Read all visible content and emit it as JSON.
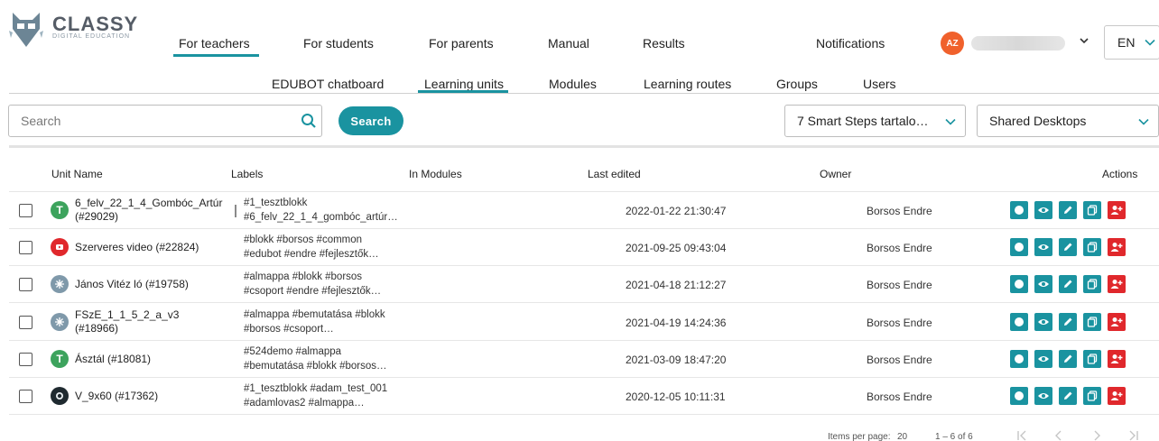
{
  "brand": {
    "name": "CLASSY",
    "tagline": "DIGITAL EDUCATION"
  },
  "top_nav": [
    {
      "label": "For teachers",
      "active": true
    },
    {
      "label": "For students"
    },
    {
      "label": "For parents"
    },
    {
      "label": "Manual"
    },
    {
      "label": "Results"
    },
    {
      "label": "Notifications"
    }
  ],
  "user": {
    "initials": "AZ",
    "avatar_color": "#f0612c"
  },
  "language": {
    "value": "EN"
  },
  "sub_nav": [
    {
      "label": "EDUBOT chatboard"
    },
    {
      "label": "Learning units",
      "active": true
    },
    {
      "label": "Modules"
    },
    {
      "label": "Learning routes"
    },
    {
      "label": "Groups"
    },
    {
      "label": "Users"
    }
  ],
  "toolbar": {
    "search_placeholder": "Search",
    "search_value": "",
    "search_button": "Search",
    "filter_1": "7 Smart Steps tartalo…",
    "filter_2": "Shared Desktops"
  },
  "table": {
    "columns": {
      "unit_name": "Unit Name",
      "labels": "Labels",
      "in_modules": "In Modules",
      "last_edited": "Last edited",
      "owner": "Owner",
      "actions": "Actions"
    },
    "rows": [
      {
        "icon": "letter-t-icon",
        "icon_text": "T",
        "icon_color": "#3da35d",
        "name_line1": "6_felv_22_1_4_Gombóc_Artúr",
        "name_line2": "(#29029)",
        "labels_line1": "#1_tesztblokk",
        "labels_line2": "#6_felv_22_1_4_gombóc_artúr…",
        "in_modules": "",
        "last_edited": "2022-01-22 21:30:47",
        "owner": "Borsos Endre"
      },
      {
        "icon": "video-play-icon",
        "icon_text": "",
        "icon_color": "#e0282c",
        "name_line1": "Szerveres video (#22824)",
        "name_line2": "",
        "labels_line1": "#blokk #borsos #common",
        "labels_line2": "#edubot #endre #fejlesztők…",
        "in_modules": "",
        "last_edited": "2021-09-25 09:43:04",
        "owner": "Borsos Endre"
      },
      {
        "icon": "unit-logo-icon",
        "icon_text": "",
        "icon_color": "#7f99aa",
        "name_line1": "János Vitéz ló (#19758)",
        "name_line2": "",
        "labels_line1": "#almappa #blokk #borsos",
        "labels_line2": "#csoport #endre #fejlesztők…",
        "in_modules": "",
        "last_edited": "2021-04-18 21:12:27",
        "owner": "Borsos Endre"
      },
      {
        "icon": "unit-logo-icon",
        "icon_text": "",
        "icon_color": "#7f99aa",
        "name_line1": "FSzE_1_1_5_2_a_v3",
        "name_line2": "(#18966)",
        "labels_line1": "#almappa #bemutatása #blokk",
        "labels_line2": "#borsos #csoport…",
        "in_modules": "",
        "last_edited": "2021-04-19 14:24:36",
        "owner": "Borsos Endre"
      },
      {
        "icon": "letter-t-icon",
        "icon_text": "T",
        "icon_color": "#3da35d",
        "name_line1": "Ásztál (#18081)",
        "name_line2": "",
        "labels_line1": "#524demo #almappa",
        "labels_line2": "#bemutatása #blokk #borsos…",
        "in_modules": "",
        "last_edited": "2021-03-09 18:47:20",
        "owner": "Borsos Endre"
      },
      {
        "icon": "dark-circle-icon",
        "icon_text": "",
        "icon_color": "#1f2a30",
        "name_line1": "V_9x60 (#17362)",
        "name_line2": "",
        "labels_line1": "#1_tesztblokk #adam_test_001",
        "labels_line2": "#adamlovas2 #almappa…",
        "in_modules": "",
        "last_edited": "2020-12-05 10:11:31",
        "owner": "Borsos Endre"
      }
    ]
  },
  "actions": [
    "info-icon",
    "preview-eye-icon",
    "edit-pencil-icon",
    "copy-icon",
    "share-user-icon"
  ],
  "paginator": {
    "items_per_page_label": "Items per page:",
    "items_per_page": "20",
    "range": "1 – 6 of 6"
  },
  "colors": {
    "accent": "#1a93a0",
    "danger": "#e0282c"
  }
}
